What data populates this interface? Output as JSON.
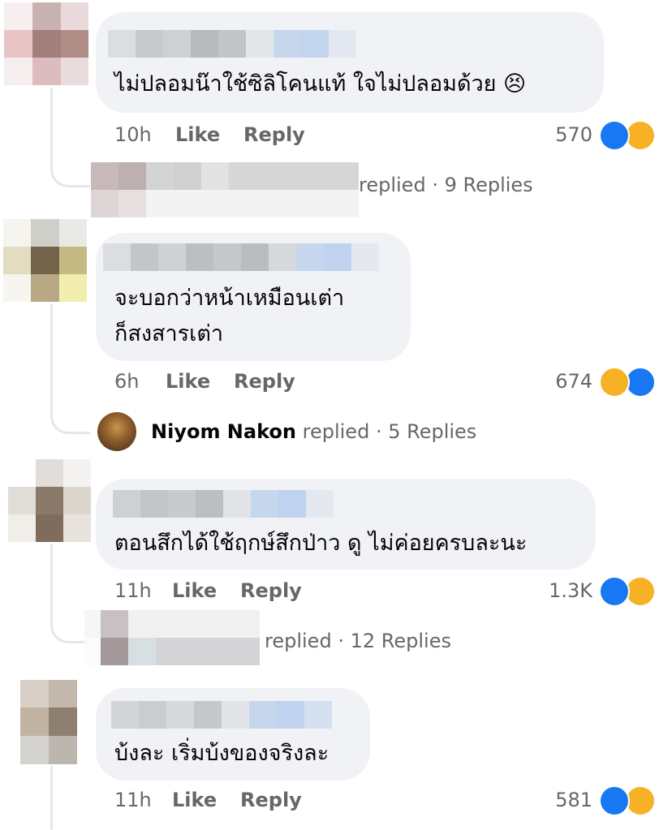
{
  "comments": [
    {
      "text": "ไม่ปลอมน๊าใช้ซิลิโคนแท้ ใจไม่ปลอมด้วย 😣",
      "time": "10h",
      "like": "Like",
      "reply": "Reply",
      "reaction_count": "570",
      "reactions": [
        "like-icon",
        "haha-icon"
      ],
      "replies": {
        "author": "",
        "action": "replied",
        "summary": "· 9 Replies"
      }
    },
    {
      "text_line1": "จะบอกว่าหน้าเหมือนเต่า",
      "text_line2": "ก็สงสารเต่า",
      "time": "6h",
      "like": "Like",
      "reply": "Reply",
      "reaction_count": "674",
      "reactions": [
        "haha-icon",
        "like-icon"
      ],
      "replies": {
        "author": "Niyom Nakon",
        "action": "replied",
        "summary": "· 5 Replies"
      }
    },
    {
      "text": "ตอนสึกได้ใช้ฤกษ์สึกป่าว ดู ไม่ค่อยครบละนะ",
      "time": "11h",
      "like": "Like",
      "reply": "Reply",
      "reaction_count": "1.3K",
      "reactions": [
        "like-icon",
        "haha-icon"
      ],
      "replies": {
        "author": "",
        "action": "replied",
        "summary": "· 12 Replies"
      }
    },
    {
      "text": "บ้งละ เริ่มบ้งของจริงละ",
      "time": "11h",
      "like": "Like",
      "reply": "Reply",
      "reaction_count": "581",
      "reactions": [
        "like-icon",
        "haha-icon"
      ]
    }
  ],
  "colors": {
    "like_blue": "#1877f2",
    "haha_yellow": "#f7b125",
    "bubble": "#f0f2f5",
    "meta_gray": "#65676b"
  }
}
